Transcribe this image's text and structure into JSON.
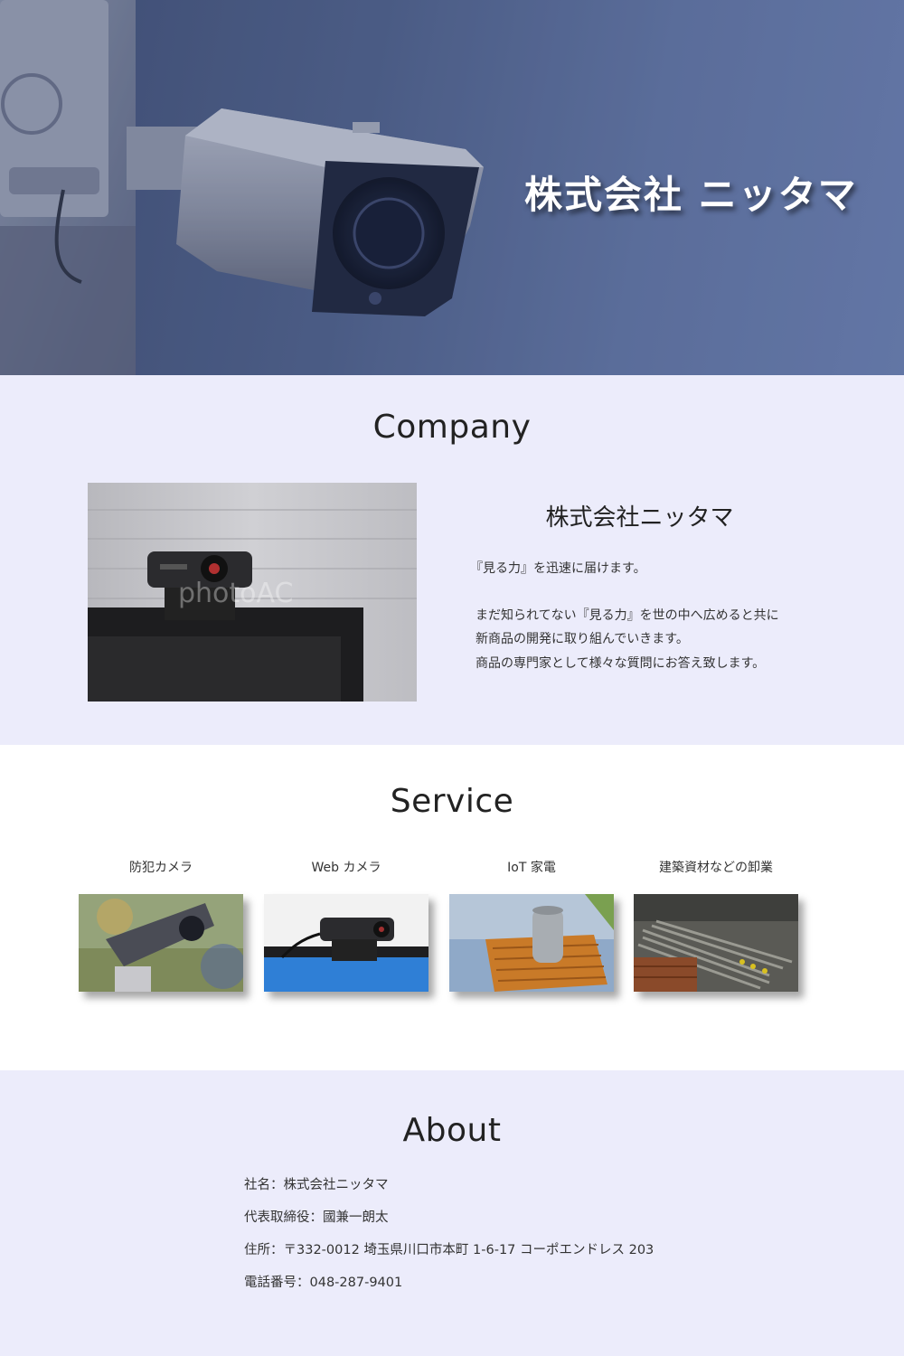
{
  "hero": {
    "title": "株式会社 ニッタマ"
  },
  "company": {
    "heading": "Company",
    "name": "株式会社ニッタマ",
    "lines": [
      "『見る力』を迅速に届けます。",
      "まだ知られてない『見る力』を世の中へ広めると共に",
      "新商品の開発に取り組んでいきます。",
      "商品の専門家として様々な質問にお答え致します。"
    ],
    "watermark": "photoAC"
  },
  "service": {
    "heading": "Service",
    "items": [
      {
        "label": "防犯カメラ",
        "icon": "security-camera-photo"
      },
      {
        "label": "Web カメラ",
        "icon": "webcam-photo"
      },
      {
        "label": "IoT 家電",
        "icon": "smart-speaker-photo"
      },
      {
        "label": "建築資材などの卸業",
        "icon": "building-materials-photo"
      }
    ]
  },
  "about": {
    "heading": "About",
    "rows": [
      "社名：株式会社ニッタマ",
      "代表取締役：國兼一朗太",
      "住所：〒332-0012 埼玉県川口市本町 1-6-17 コーポエンドレス 203",
      "電話番号：048-287-9401"
    ]
  },
  "colors": {
    "section_bg": "#ececfb",
    "hero_tint": "#56698f",
    "text": "#222222"
  }
}
